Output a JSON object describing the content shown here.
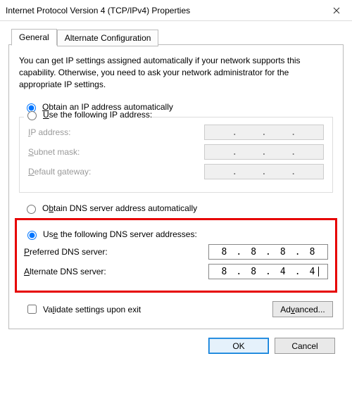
{
  "window": {
    "title": "Internet Protocol Version 4 (TCP/IPv4) Properties"
  },
  "tabs": {
    "general": "General",
    "alternate": "Alternate Configuration"
  },
  "description": "You can get IP settings assigned automatically if your network supports this capability. Otherwise, you need to ask your network administrator for the appropriate IP settings.",
  "ip": {
    "obtain_auto": "btain an IP address automatically",
    "obtain_auto_u": "O",
    "use_following": "se the following IP address:",
    "use_following_u": "U",
    "address_label_u": "I",
    "address_label": "P address:",
    "subnet_label": "S",
    "subnet_rest": "ubnet mask:",
    "gateway_label": "D",
    "gateway_rest": "efault gateway:"
  },
  "dns": {
    "obtain_auto_u": "b",
    "obtain_auto_pre": "O",
    "obtain_auto_post": "tain DNS server address automatically",
    "use_following_u": "e",
    "use_following_pre": "Us",
    "use_following_post": " the following DNS server addresses:",
    "preferred_u": "P",
    "preferred_rest": "referred DNS server:",
    "alternate_u": "A",
    "alternate_rest": "lternate DNS server:",
    "preferred_value": [
      "8",
      "8",
      "8",
      "8"
    ],
    "alternate_value": [
      "8",
      "8",
      "4",
      "4"
    ]
  },
  "validate": {
    "u": "l",
    "pre": "Va",
    "post": "idate settings upon exit"
  },
  "buttons": {
    "advanced_u": "v",
    "advanced_pre": "Ad",
    "advanced_post": "anced...",
    "ok": "OK",
    "cancel": "Cancel"
  }
}
